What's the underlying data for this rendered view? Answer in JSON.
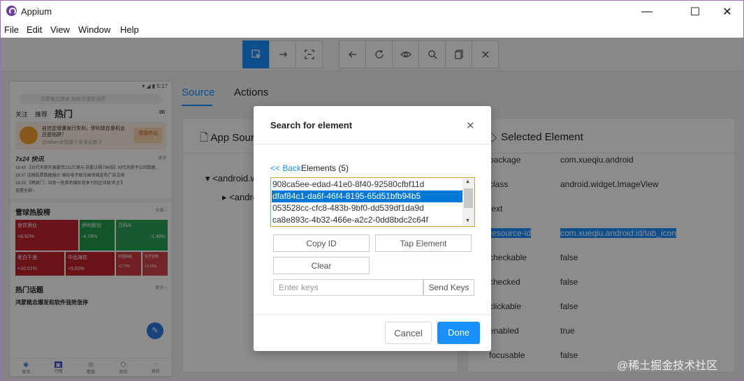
{
  "window": {
    "title": "Appium",
    "controls": {
      "minimize": "—",
      "maximize": "☐",
      "close": "✕"
    }
  },
  "menu": [
    "File",
    "Edit",
    "View",
    "Window",
    "Help"
  ],
  "toolbar": {
    "icons": [
      "select-element-icon",
      "swipe-icon",
      "tap-coordinates-icon",
      "back-icon",
      "refresh-icon",
      "eye-icon",
      "search-icon",
      "copy-xml-icon",
      "quit-session-icon"
    ],
    "active_index": 0
  },
  "phone": {
    "status": "▾ ◢ ▮ 5:17",
    "search_placeholder": "鸿蒙概念爆发 和软件强势涨停",
    "tabs": [
      "关注",
      "推荐",
      "热门"
    ],
    "banner_text": "自信定增遭发行失利，伊利现在是机会还是陷阱？",
    "banner_user": "@stiker@雪球千金求记者子",
    "banner_button": "雪球热议",
    "section_news": "7x24 快讯",
    "section_news_more": "更多",
    "news": [
      "16:43 【对代天使开展募资231亿港元 前股认购796倍】对代天使子公司数据…",
      "16:37 法国股票数据报价 国际电子联合国领域宣布广告立场",
      "16:23 【两部门：培育一批具有国际竞争力的区块链'名企'】",
      "查看全部 ›"
    ],
    "section_hot": "雪球热股榜",
    "section_hot_more": "全部 ›",
    "heat_cells": [
      {
        "name": "食饮酒业",
        "change": "+8.92%",
        "color": "#c0232c"
      },
      {
        "name": "伊利股份",
        "change": "-4.78%",
        "color": "#1f9c4a"
      },
      {
        "name": "万科A",
        "change": "-1.48%",
        "color": "#2aa556"
      },
      {
        "name": "老白干酒",
        "change": "+10.01%",
        "color": "#c0232c"
      },
      {
        "name": "中远海控",
        "change": "+5.63%",
        "color": "#c0232c"
      },
      {
        "name": "中国船舶",
        "change": "+2.72%",
        "color": "#cc3a3f"
      },
      {
        "name": "东方证券",
        "change": "+3.16%",
        "color": "#d04347"
      }
    ],
    "section_topic": "热门话题",
    "section_topic_more": "更多 ›",
    "topic_item": "鸿蒙概念爆发和软件强势涨停",
    "nav": [
      "首页",
      "行情",
      "看盘",
      "资讯",
      "我的"
    ]
  },
  "tabs": {
    "source": "Source",
    "actions": "Actions"
  },
  "source_panel": {
    "title": "App Source",
    "tree": [
      "▾  <android.widget.FrameLayout>",
      "▸  <android.widget.LinearLayout>"
    ]
  },
  "selected_panel": {
    "title": "Selected Element",
    "attributes": [
      {
        "key": "package",
        "value": "com.xueqiu.android"
      },
      {
        "key": "class",
        "value": "android.widget.ImageView"
      },
      {
        "key": "text",
        "value": ""
      },
      {
        "key": "resource-id",
        "value": "com.xueqiu.android:id/tab_icon"
      },
      {
        "key": "checkable",
        "value": "false"
      },
      {
        "key": "checked",
        "value": "false"
      },
      {
        "key": "clickable",
        "value": "false"
      },
      {
        "key": "enabled",
        "value": "true"
      },
      {
        "key": "focusable",
        "value": "false"
      }
    ],
    "highlighted": "resource-id"
  },
  "modal": {
    "title": "Search for element",
    "close": "✕",
    "back": "<< Back",
    "elements_label": "Elements (5)",
    "elements": [
      "908ca5ee-edad-41e0-8f40-92580cfbf11d",
      "dfaf84c1-da6f-46f4-8195-65d51bfb94b5",
      "053528cc-cfc8-483b-9bf0-dd539df1da9d",
      "ca8e893c-4b32-466e-a2c2-0dd8bdc2c64f"
    ],
    "selected_index": 1,
    "copy_id": "Copy ID",
    "tap_element": "Tap Element",
    "clear": "Clear",
    "keys_placeholder": "Enter keys",
    "send_keys": "Send Keys",
    "cancel": "Cancel",
    "done": "Done"
  },
  "watermark": "@稀土掘金技术社区"
}
